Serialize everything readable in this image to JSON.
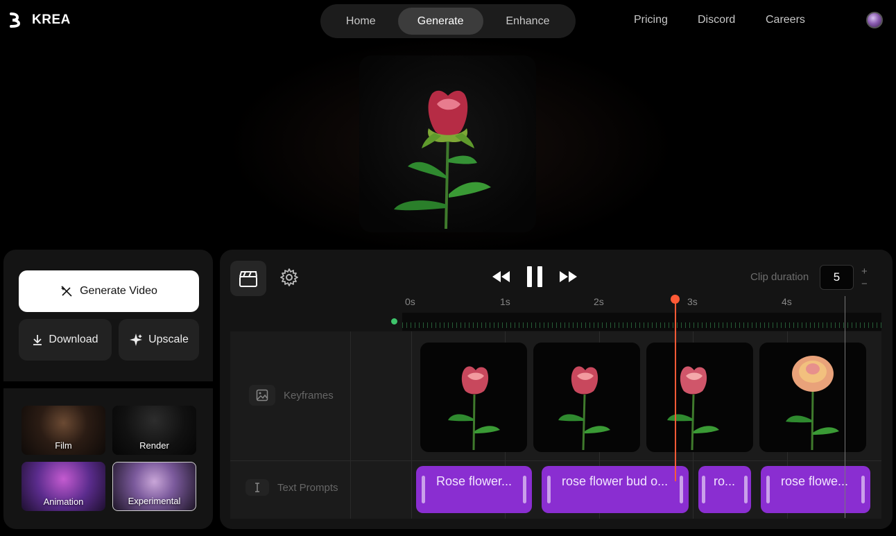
{
  "brand": {
    "name": "KREA"
  },
  "nav": {
    "tabs": [
      {
        "label": "Home"
      },
      {
        "label": "Generate",
        "active": true
      },
      {
        "label": "Enhance"
      }
    ],
    "links": [
      "Pricing",
      "Discord",
      "Careers"
    ]
  },
  "actions": {
    "generate_video": "Generate Video",
    "download": "Download",
    "upscale": "Upscale"
  },
  "styles": [
    {
      "label": "Film"
    },
    {
      "label": "Render"
    },
    {
      "label": "Animation"
    },
    {
      "label": "Experimental",
      "selected": true
    }
  ],
  "timeline": {
    "clip_duration_label": "Clip duration",
    "clip_duration_value": "5",
    "ticks": [
      "0s",
      "1s",
      "2s",
      "3s",
      "4s"
    ],
    "playhead_seconds": 2.8,
    "tracks": {
      "keyframes_label": "Keyframes",
      "text_prompts_label": "Text Prompts"
    },
    "keyframes": [
      {
        "name": "rose-bud-1"
      },
      {
        "name": "rose-bud-2"
      },
      {
        "name": "rose-bud-3"
      },
      {
        "name": "rose-bloom"
      }
    ],
    "prompts": [
      {
        "text": "Rose flower..."
      },
      {
        "text": "rose flower bud o..."
      },
      {
        "text": "ro..."
      },
      {
        "text": "rose flowe..."
      }
    ]
  },
  "colors": {
    "accent_prompt": "#8a2ed1",
    "playhead": "#ff5a36",
    "scrub_start": "#3ec46b"
  }
}
